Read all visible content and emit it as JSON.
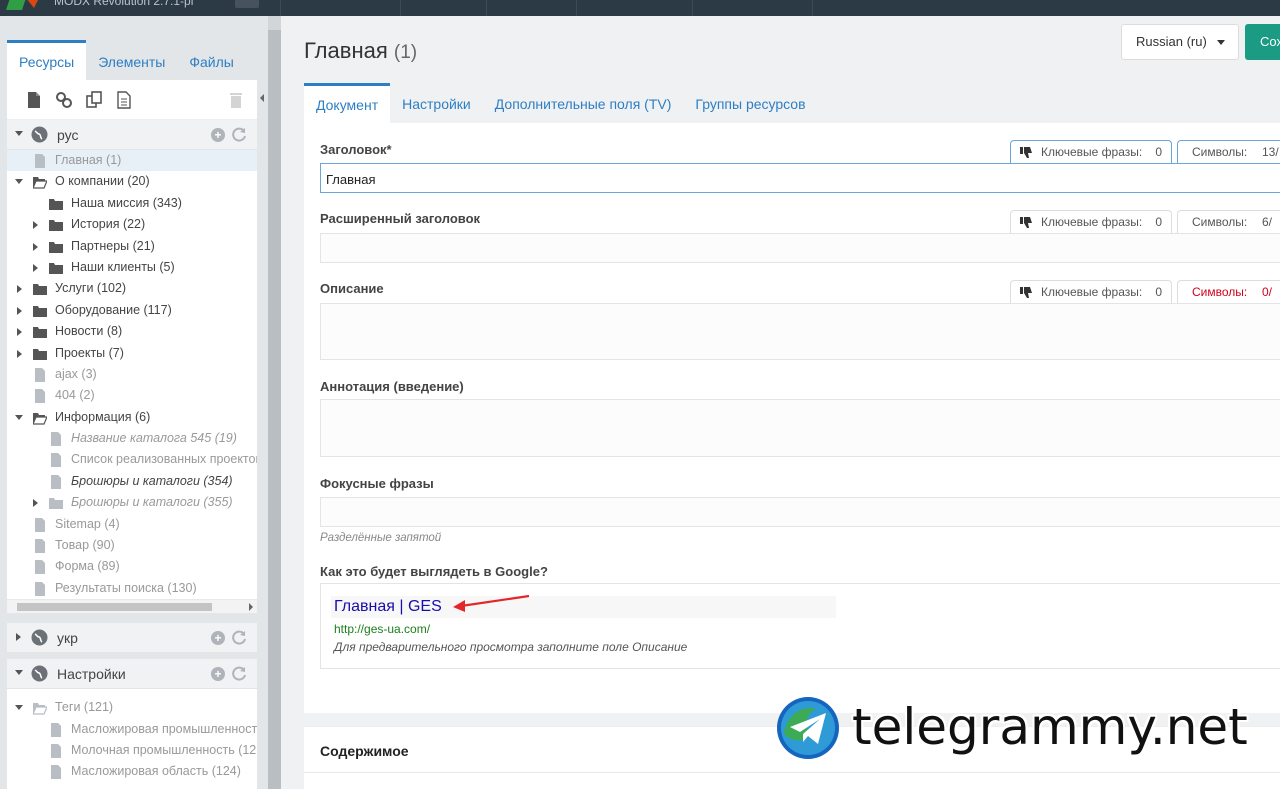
{
  "topbar": {
    "site_name": "MODX Revolution 2.7.1-pl"
  },
  "left": {
    "tabs": [
      "Ресурсы",
      "Элементы",
      "Файлы"
    ],
    "contexts": {
      "rus": "рус",
      "ukr": "укр",
      "settings": "Настройки"
    },
    "tree": [
      {
        "label": "Главная (1)",
        "depth": 0,
        "kind": "doc",
        "style": "grey"
      },
      {
        "label": "О компании (20)",
        "depth": 0,
        "kind": "folder-open",
        "style": "dark"
      },
      {
        "label": "Наша миссия (343)",
        "depth": 1,
        "kind": "folder",
        "style": "dark"
      },
      {
        "label": "История (22)",
        "depth": 1,
        "kind": "folder-closed",
        "style": "dark"
      },
      {
        "label": "Партнеры (21)",
        "depth": 1,
        "kind": "folder-closed",
        "style": "dark"
      },
      {
        "label": "Наши клиенты (5)",
        "depth": 1,
        "kind": "folder-closed",
        "style": "dark"
      },
      {
        "label": "Услуги (102)",
        "depth": 0,
        "kind": "folder-closed",
        "style": "dark"
      },
      {
        "label": "Оборудование (117)",
        "depth": 0,
        "kind": "folder-closed",
        "style": "dark"
      },
      {
        "label": "Новости (8)",
        "depth": 0,
        "kind": "folder-closed",
        "style": "dark"
      },
      {
        "label": "Проекты (7)",
        "depth": 0,
        "kind": "folder-closed",
        "style": "dark"
      },
      {
        "label": "ajax (3)",
        "depth": 0,
        "kind": "doc",
        "style": "grey"
      },
      {
        "label": "404 (2)",
        "depth": 0,
        "kind": "doc",
        "style": "grey"
      },
      {
        "label": "Информация (6)",
        "depth": 0,
        "kind": "folder-open",
        "style": "dark"
      },
      {
        "label": "Название каталога 545 (19)",
        "depth": 1,
        "kind": "doc",
        "style": "grey-italic"
      },
      {
        "label": "Список реализованных проектов",
        "depth": 1,
        "kind": "doc",
        "style": "grey"
      },
      {
        "label": "Брошюры и каталоги (354)",
        "depth": 1,
        "kind": "doc",
        "style": "dark-italic"
      },
      {
        "label": "Брошюры и каталоги (355)",
        "depth": 1,
        "kind": "folder-closed-grey",
        "style": "grey-italic"
      },
      {
        "label": "Sitemap (4)",
        "depth": 0,
        "kind": "doc",
        "style": "grey"
      },
      {
        "label": "Товар (90)",
        "depth": 0,
        "kind": "doc",
        "style": "grey"
      },
      {
        "label": "Форма (89)",
        "depth": 0,
        "kind": "doc",
        "style": "grey"
      },
      {
        "label": "Результаты поиска (130)",
        "depth": 0,
        "kind": "doc",
        "style": "grey"
      }
    ],
    "settings_tree": [
      {
        "label": "Теги (121)",
        "depth": 0,
        "kind": "folder-open-grey",
        "style": "grey"
      },
      {
        "label": "Масложировая промышленность",
        "depth": 1,
        "kind": "doc",
        "style": "grey"
      },
      {
        "label": "Молочная промышленность (12",
        "depth": 1,
        "kind": "doc",
        "style": "grey"
      },
      {
        "label": "Масложировая область (124)",
        "depth": 1,
        "kind": "doc",
        "style": "grey"
      }
    ]
  },
  "main": {
    "title": "Главная",
    "title_count": "(1)",
    "language": "Russian (ru)",
    "save_label": "Сох",
    "tabs": [
      "Документ",
      "Настройки",
      "Дополнительные поля (TV)",
      "Группы ресурсов"
    ],
    "fields": {
      "title_label": "Заголовок*",
      "title_value": "Главная",
      "longtitle_label": "Расширенный заголовок",
      "description_label": "Описание",
      "introtext_label": "Аннотация (введение)",
      "focus_label": "Фокусные фразы",
      "focus_hint": "Разделённые запятой",
      "google_label": "Как это будет выглядеть в Google?"
    },
    "seo": {
      "keywords_label": "Ключевые фразы:",
      "symbols_label": "Символы:",
      "title_kw": "0",
      "title_sym": "13/",
      "longtitle_kw": "0",
      "longtitle_sym": "6/",
      "desc_kw": "0",
      "desc_sym": "0/"
    },
    "google": {
      "title": "Главная | GES",
      "url": "http://ges-ua.com/",
      "desc": "Для предварительного просмотра заполните поле Описание"
    },
    "content_title": "Содержимое"
  },
  "watermark": {
    "text": "telegrammy.net"
  },
  "colors": {
    "accent": "#2d7fc4",
    "save": "#1c9b84",
    "google_title": "#1a0dab",
    "google_url": "#1a7f1a",
    "warning": "#d0021b"
  }
}
